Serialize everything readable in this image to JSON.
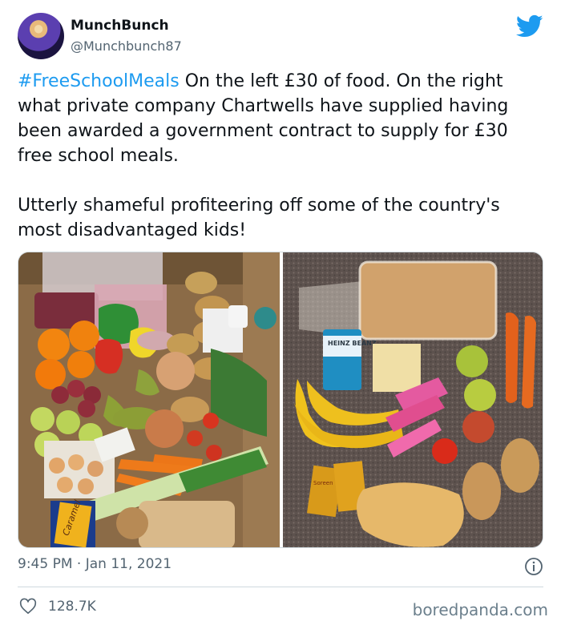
{
  "user": {
    "name": "MunchBunch",
    "handle": "@Munchbunch87"
  },
  "tweet": {
    "hashtag": "#FreeSchoolMeals",
    "text_after_hashtag": " On the left £30 of food. On the right what private company Chartwells have supplied having been awarded a government contract to supply for £30 free school meals.",
    "paragraph2": "Utterly shameful profiteering off some of the country's most disadvantaged kids!"
  },
  "media": {
    "left_labels": [
      "Caramel"
    ],
    "right_labels": [
      "HEINZ BEANZ",
      "Soreen"
    ]
  },
  "timestamp": "9:45 PM · Jan 11, 2021",
  "likes": "128.7K",
  "watermark": "boredpanda.com",
  "colors": {
    "accent": "#1d9bf0",
    "muted": "#536471"
  },
  "icons": [
    "twitter-bird-icon",
    "info-icon",
    "heart-icon"
  ]
}
